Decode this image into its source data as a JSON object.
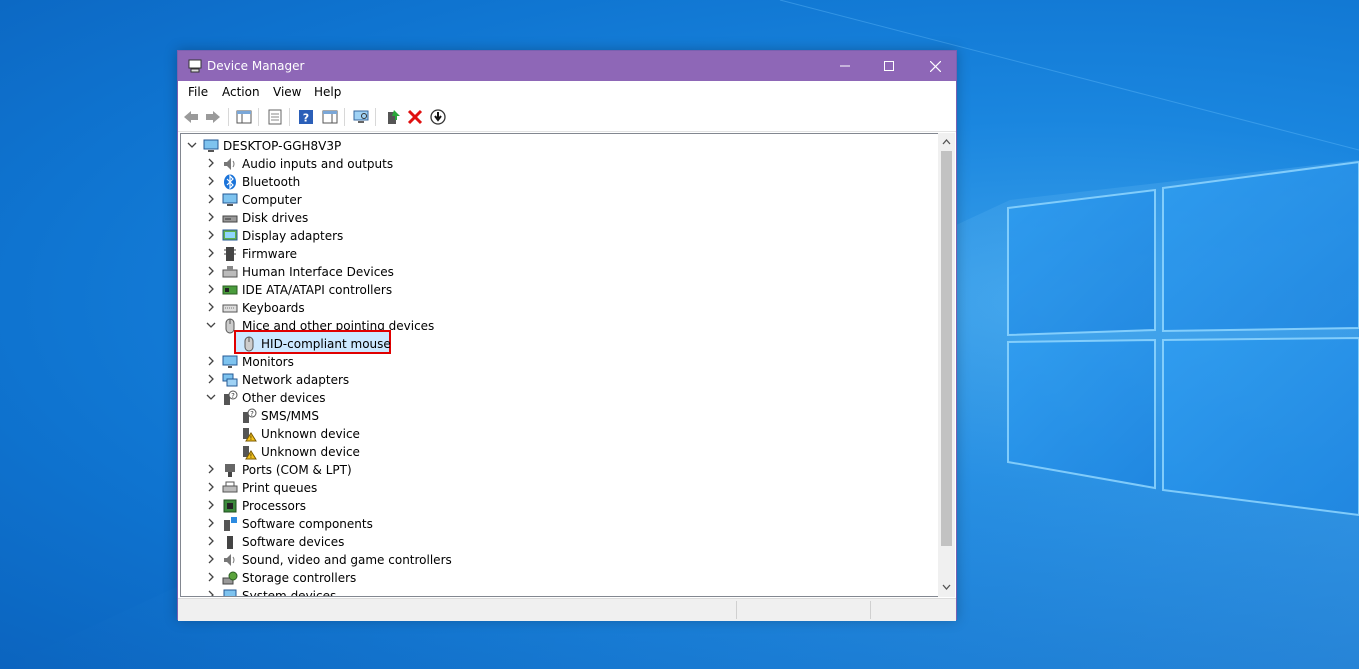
{
  "window": {
    "title": "Device Manager",
    "colors": {
      "titlebar": "#8e67b7",
      "selection_highlight": "#e00000"
    }
  },
  "menubar": {
    "items": [
      "File",
      "Action",
      "View",
      "Help"
    ]
  },
  "toolbar": {
    "icons": [
      "back-arrow-icon",
      "forward-arrow-icon",
      "console-tree-icon",
      "properties-icon",
      "help-icon",
      "action-pane-icon",
      "scan-hardware-icon",
      "update-driver-icon",
      "uninstall-device-icon",
      "disable-device-icon"
    ]
  },
  "tree": {
    "root": "DESKTOP-GGH8V3P",
    "nodes": [
      {
        "label": "Audio inputs and outputs",
        "icon": "speaker-icon",
        "expanded": false
      },
      {
        "label": "Bluetooth",
        "icon": "bluetooth-icon",
        "expanded": false
      },
      {
        "label": "Computer",
        "icon": "computer-icon",
        "expanded": false
      },
      {
        "label": "Disk drives",
        "icon": "disk-drive-icon",
        "expanded": false
      },
      {
        "label": "Display adapters",
        "icon": "display-adapter-icon",
        "expanded": false
      },
      {
        "label": "Firmware",
        "icon": "firmware-icon",
        "expanded": false
      },
      {
        "label": "Human Interface Devices",
        "icon": "hid-icon",
        "expanded": false
      },
      {
        "label": "IDE ATA/ATAPI controllers",
        "icon": "ide-controller-icon",
        "expanded": false
      },
      {
        "label": "Keyboards",
        "icon": "keyboard-icon",
        "expanded": false
      },
      {
        "label": "Mice and other pointing devices",
        "icon": "mouse-icon",
        "expanded": true
      },
      {
        "label": "HID-compliant mouse",
        "icon": "mouse-icon",
        "child": true,
        "selected": true
      },
      {
        "label": "Monitors",
        "icon": "monitor-icon",
        "expanded": false
      },
      {
        "label": "Network adapters",
        "icon": "network-adapter-icon",
        "expanded": false
      },
      {
        "label": "Other devices",
        "icon": "other-devices-icon",
        "expanded": true
      },
      {
        "label": "SMS/MMS",
        "icon": "unknown-device-icon",
        "child": true
      },
      {
        "label": "Unknown device",
        "icon": "warning-device-icon",
        "child": true
      },
      {
        "label": "Unknown device",
        "icon": "warning-device-icon",
        "child": true
      },
      {
        "label": "Ports (COM & LPT)",
        "icon": "port-icon",
        "expanded": false
      },
      {
        "label": "Print queues",
        "icon": "printer-icon",
        "expanded": false
      },
      {
        "label": "Processors",
        "icon": "processor-icon",
        "expanded": false
      },
      {
        "label": "Software components",
        "icon": "software-component-icon",
        "expanded": false
      },
      {
        "label": "Software devices",
        "icon": "software-device-icon",
        "expanded": false
      },
      {
        "label": "Sound, video and game controllers",
        "icon": "speaker-icon",
        "expanded": false
      },
      {
        "label": "Storage controllers",
        "icon": "storage-controller-icon",
        "expanded": false
      },
      {
        "label": "System devices",
        "icon": "system-device-icon",
        "expanded": false
      }
    ]
  }
}
